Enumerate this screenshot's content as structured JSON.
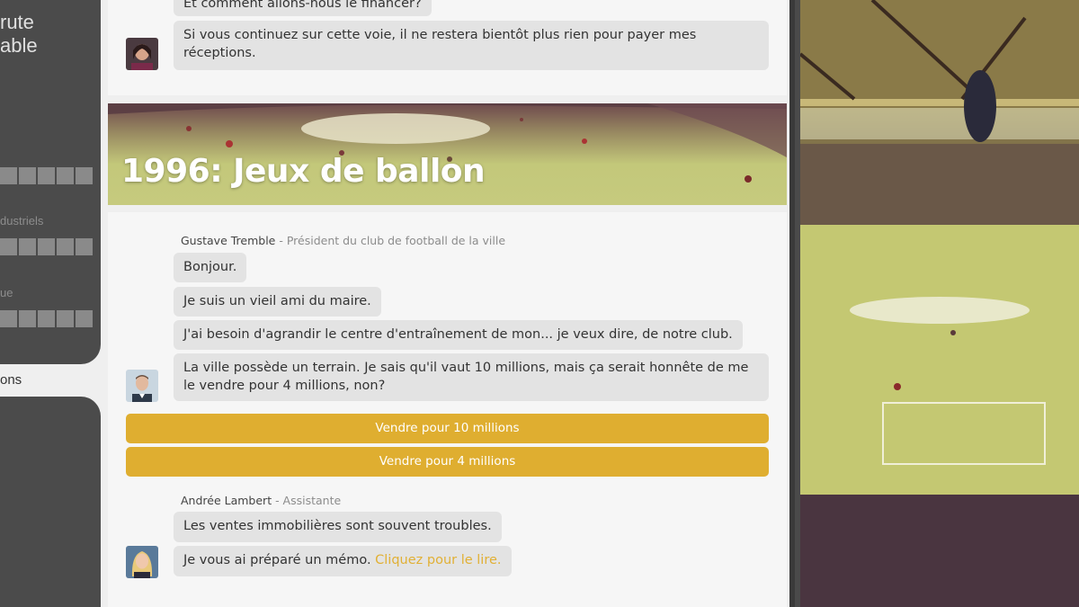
{
  "sidebar": {
    "title_line1": "rute",
    "title_line2": "able",
    "section_industry": "dustriels",
    "section_other": "ue",
    "active_item": "ons"
  },
  "chat_top": {
    "partial_message": "Et comment allons-nous le financer?",
    "message": "Si vous continuez sur cette voie, il ne restera bientôt plus rien pour payer mes réceptions."
  },
  "banner": {
    "title": "1996: Jeux de ballon"
  },
  "conversation1": {
    "speaker_name": "Gustave Tremble",
    "speaker_role": " - Président du club de football de la ville",
    "messages": [
      "Bonjour.",
      "Je suis un vieil ami du maire.",
      "J'ai besoin d'agrandir le centre d'entraînement de mon... je veux dire, de notre club.",
      "La ville possède un terrain. Je sais qu'il vaut 10 millions, mais ça serait honnête de me le vendre pour 4 millions, non?"
    ]
  },
  "choices": [
    "Vendre pour 10 millions",
    "Vendre pour 4 millions"
  ],
  "conversation2": {
    "speaker_name": "Andrée Lambert",
    "speaker_role": " - Assistante",
    "messages": [
      "Les ventes immobilières sont souvent troubles.",
      "Je vous ai préparé un mémo. "
    ],
    "link": "Cliquez pour le lire."
  },
  "colors": {
    "accent": "#dfae30",
    "sidebar": "#4b4b4b",
    "bubble": "#e3e3e3"
  }
}
